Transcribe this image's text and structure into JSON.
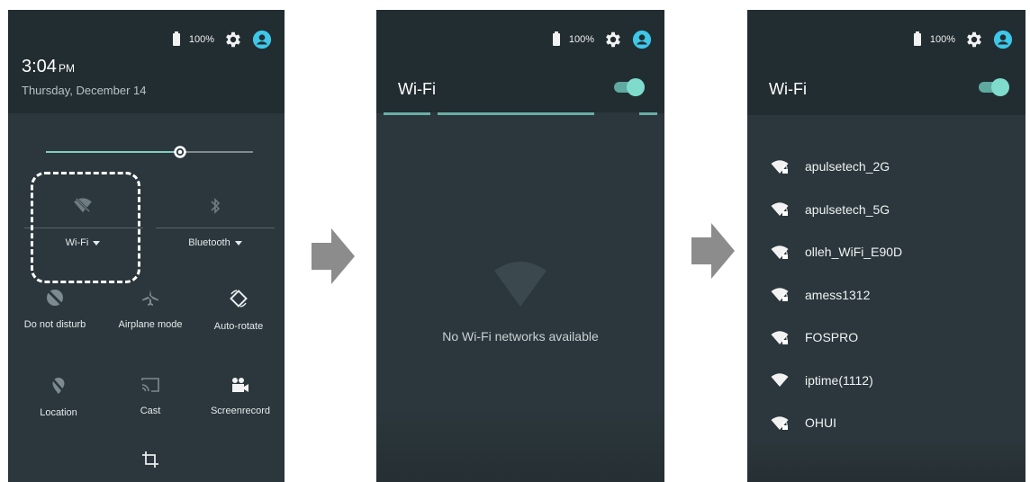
{
  "panel1": {
    "battery_pct": "100%",
    "time": "3:04",
    "time_suffix": "PM",
    "date": "Thursday, December 14",
    "brightness_level": 0.66,
    "tiles": [
      {
        "label": "Wi-Fi",
        "icon": "wifi-off-icon",
        "has_dropdown": true
      },
      {
        "label": "Bluetooth",
        "icon": "bluetooth-off-icon",
        "has_dropdown": true
      },
      {
        "label": "Do not disturb",
        "icon": "do-not-disturb-icon"
      },
      {
        "label": "Airplane mode",
        "icon": "airplane-icon"
      },
      {
        "label": "Auto-rotate",
        "icon": "auto-rotate-icon"
      },
      {
        "label": "Location",
        "icon": "location-off-icon"
      },
      {
        "label": "Cast",
        "icon": "cast-icon"
      },
      {
        "label": "Screenrecord",
        "icon": "screenrecord-icon"
      }
    ]
  },
  "panel2": {
    "battery_pct": "100%",
    "title": "Wi-Fi",
    "toggle_on": true,
    "empty_message": "No Wi-Fi networks available"
  },
  "panel3": {
    "battery_pct": "100%",
    "title": "Wi-Fi",
    "toggle_on": true,
    "networks": [
      {
        "name": "apulsetech_2G",
        "secured": true
      },
      {
        "name": "apulsetech_5G",
        "secured": true
      },
      {
        "name": "olleh_WiFi_E90D",
        "secured": true
      },
      {
        "name": "amess1312",
        "secured": true
      },
      {
        "name": "FOSPRO",
        "secured": true
      },
      {
        "name": "iptime(1112)",
        "secured": false
      },
      {
        "name": "OHUI",
        "secured": true
      }
    ]
  },
  "colors": {
    "background": "#2b373c",
    "header": "#222d31",
    "accent": "#7fdccd",
    "avatar": "#3ec7e8",
    "arrow": "#8c8c8c",
    "highlight_border": "#ffffff"
  }
}
